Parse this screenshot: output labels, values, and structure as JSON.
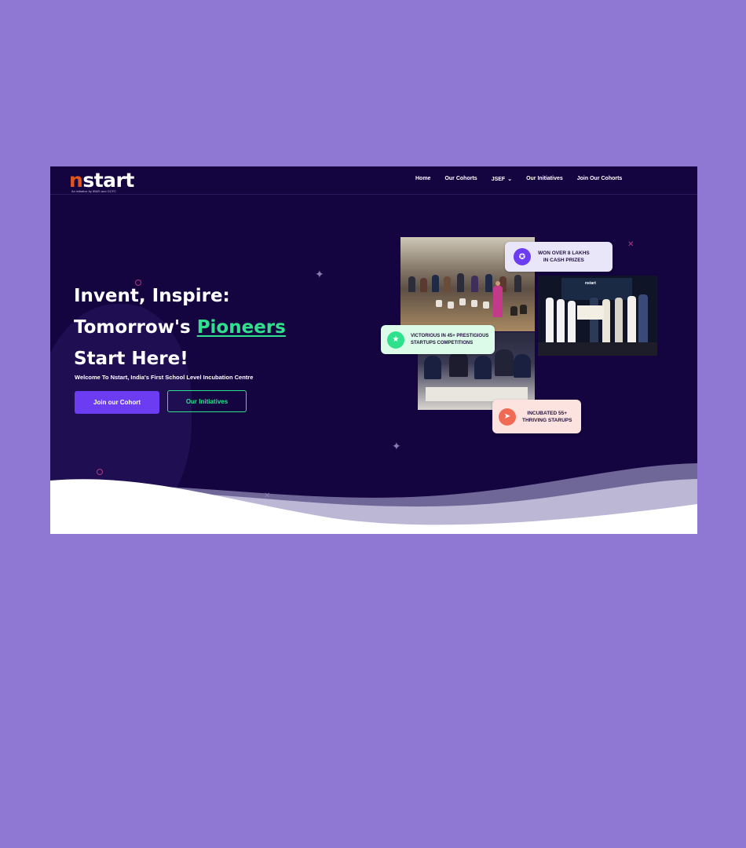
{
  "brand": {
    "logo_text_n": "n",
    "logo_text_rest": "start",
    "logo_tagline": "An initiative by IBMS and GCFC"
  },
  "nav": {
    "items": [
      {
        "label": "Home"
      },
      {
        "label": "Our Cohorts"
      },
      {
        "label": "JSEF"
      },
      {
        "label": "Our Initiatives"
      },
      {
        "label": "Join Our Cohorts"
      }
    ]
  },
  "hero": {
    "title_line1": "Invent, Inspire:",
    "title_line2_prefix": "Tomorrow's ",
    "title_line2_highlight": "Pioneers",
    "title_line3": "Start Here!",
    "subtitle": "Welcome To Nstart, India's First School Level Incubation Centre",
    "primary_button": "Join our Cohort",
    "secondary_button": "Our Initiatives"
  },
  "badges": {
    "prizes_line1": "WON OVER 8 LAKHS",
    "prizes_line2": "IN CASH PRIZES",
    "competitions_line1": "VICTORIOUS IN 45+ PRESTIGIOUS",
    "competitions_line2": "STARTUPS COMPETITIONS",
    "startups_line1": "INCUBATED 55+",
    "startups_line2": "THRIVING STARUPS"
  },
  "photos": {
    "team_stage_label": "nstart"
  },
  "colors": {
    "page_bg": "#8e78d3",
    "site_bg": "#14043f",
    "accent_purple": "#6c3cf2",
    "accent_green": "#2fe08d",
    "logo_orange": "#e2561d"
  },
  "icons": {
    "prizes": "award-medal-icon",
    "competitions": "trophy-icon",
    "startups": "rocket-icon",
    "nav_dropdown": "chevron-down-icon"
  }
}
